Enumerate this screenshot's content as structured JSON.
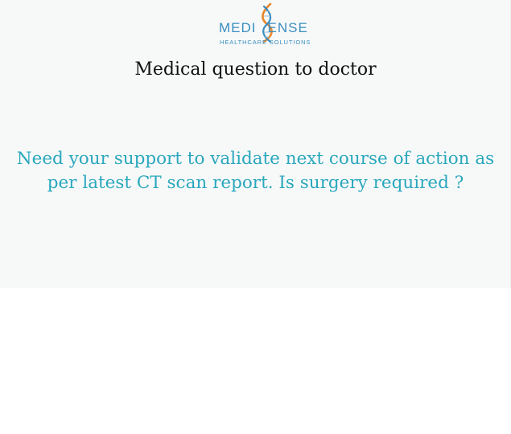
{
  "brand": {
    "name_left": "MEDI",
    "name_right": "ENSE",
    "tagline": "HEALTHCARE SOLUTIONS",
    "colors": {
      "text": "#3b8ec0",
      "helix_orange": "#e8872a",
      "helix_blue": "#3b8ec0"
    },
    "icon": "dna-helix-icon"
  },
  "page": {
    "title": "Medical question to doctor",
    "question": "Need your support to validate next course of action as per latest CT scan report. Is surgery required ?"
  },
  "colors": {
    "question_text": "#2aa7bd",
    "title_text": "#111111",
    "card_background": "#f7f9f9"
  }
}
